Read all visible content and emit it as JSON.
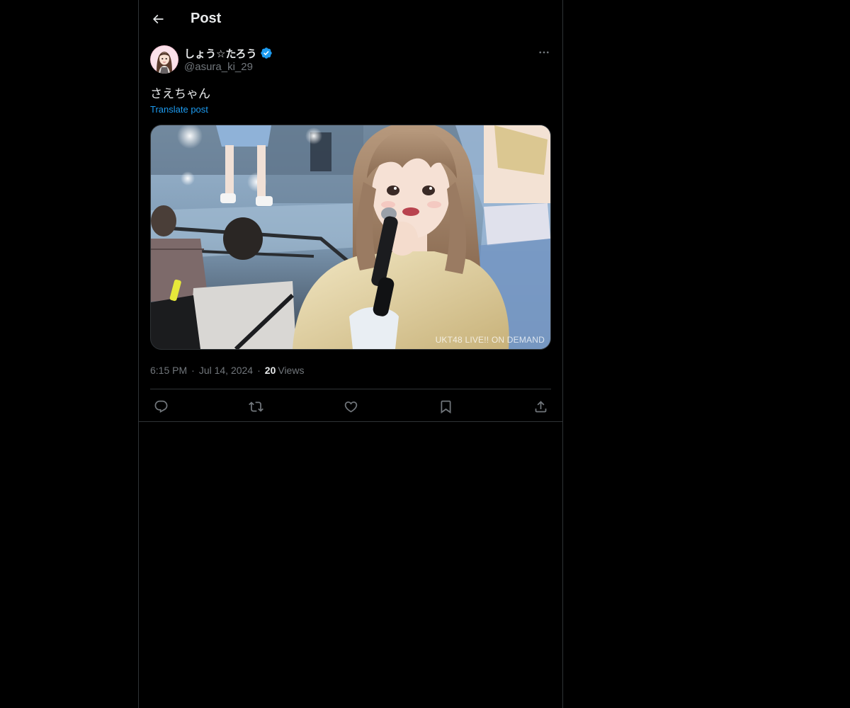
{
  "header": {
    "title": "Post",
    "back_icon": "arrow-left-icon"
  },
  "post": {
    "author": {
      "display_name": "しょう☆たろう",
      "handle": "@asura_ki_29",
      "verified": true,
      "verified_color": "#1d9bf0"
    },
    "text": "さえちゃん",
    "translate_label": "Translate post",
    "media": {
      "watermark": "UKT48 LIVE!! ON DEMAND"
    },
    "meta": {
      "time": "6:15 PM",
      "separator": "·",
      "date": "Jul 14, 2024",
      "views_count": "20",
      "views_label": "Views"
    },
    "actions": [
      {
        "name": "reply",
        "icon": "reply-icon"
      },
      {
        "name": "repost",
        "icon": "repost-icon"
      },
      {
        "name": "like",
        "icon": "heart-icon"
      },
      {
        "name": "bookmark",
        "icon": "bookmark-icon"
      },
      {
        "name": "share",
        "icon": "share-icon"
      }
    ]
  },
  "colors": {
    "background": "#000000",
    "text_primary": "#e7e9ea",
    "text_secondary": "#71767b",
    "accent": "#1d9bf0",
    "border": "#2f3336"
  }
}
